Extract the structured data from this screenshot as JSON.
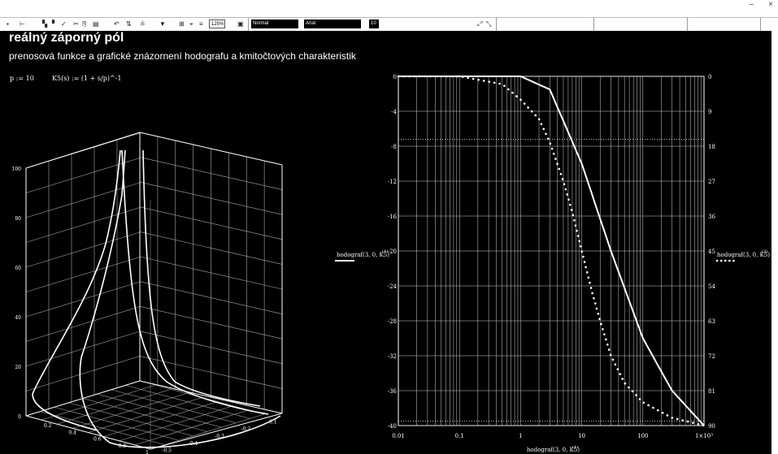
{
  "window": {
    "minimize_label": "–",
    "close_label": "×"
  },
  "toolbar": {
    "zoom": "125%",
    "style_value": "Normal",
    "font_value": "Arial",
    "size_value": "10"
  },
  "document": {
    "title": "reálný záporný pól",
    "subtitle": "prenosová funkce a grafické znázornení hodografu a kmitočtových charakteristik",
    "p_def": "p := 10",
    "k_def": "K5(s) := (1 + s/p)^-1"
  },
  "plot3d": {
    "z_ticks": [
      "0",
      "20",
      "40",
      "60",
      "80",
      "100"
    ],
    "front_ticks": [
      "0.2",
      "0.4",
      "0.6",
      "0.8",
      "1"
    ],
    "side_ticks": [
      "-0.5",
      "-0.4",
      "-0.3",
      "-0.2",
      "-0.1"
    ]
  },
  "chart_data": {
    "type": "line",
    "x_scale": "log",
    "x_ticks": [
      "0.01",
      "0.1",
      "1",
      "10",
      "100",
      "1×10³"
    ],
    "xlim": [
      0.01,
      1000
    ],
    "y_left_ticks": [
      "0",
      "-4",
      "-8",
      "-12",
      "-16",
      "-20",
      "-24",
      "-28",
      "-32",
      "-36",
      "-40"
    ],
    "ylim_left": [
      -40,
      0
    ],
    "y_right_ticks": [
      "0",
      "9",
      "18",
      "27",
      "36",
      "45",
      "54",
      "63",
      "72",
      "81",
      "90"
    ],
    "ylim_right": [
      0,
      90
    ],
    "xlabel": "hodograf(3, 0, K5)",
    "xlabel_sup": "(1)",
    "left_label": "hodograf(3, 0, K5)",
    "left_label_sup": "(4)",
    "right_label": "hodograf(3, 0, K5)",
    "right_label_sup": "(3)",
    "series": [
      {
        "style": "solid",
        "axis": "left",
        "x": [
          0.01,
          0.1,
          1,
          3,
          10,
          30,
          100,
          300,
          1000
        ],
        "y": [
          0,
          0,
          0,
          -1.5,
          -10,
          -20,
          -30,
          -36,
          -40
        ]
      },
      {
        "style": "dotted",
        "axis": "right",
        "x": [
          0.01,
          0.1,
          0.5,
          1,
          2,
          3,
          5,
          7,
          10,
          15,
          20,
          30,
          50,
          100,
          300,
          1000
        ],
        "y": [
          0,
          0,
          2,
          6,
          11,
          17,
          27,
          35,
          45,
          56,
          63,
          72,
          79,
          84,
          88,
          90
        ]
      }
    ]
  }
}
